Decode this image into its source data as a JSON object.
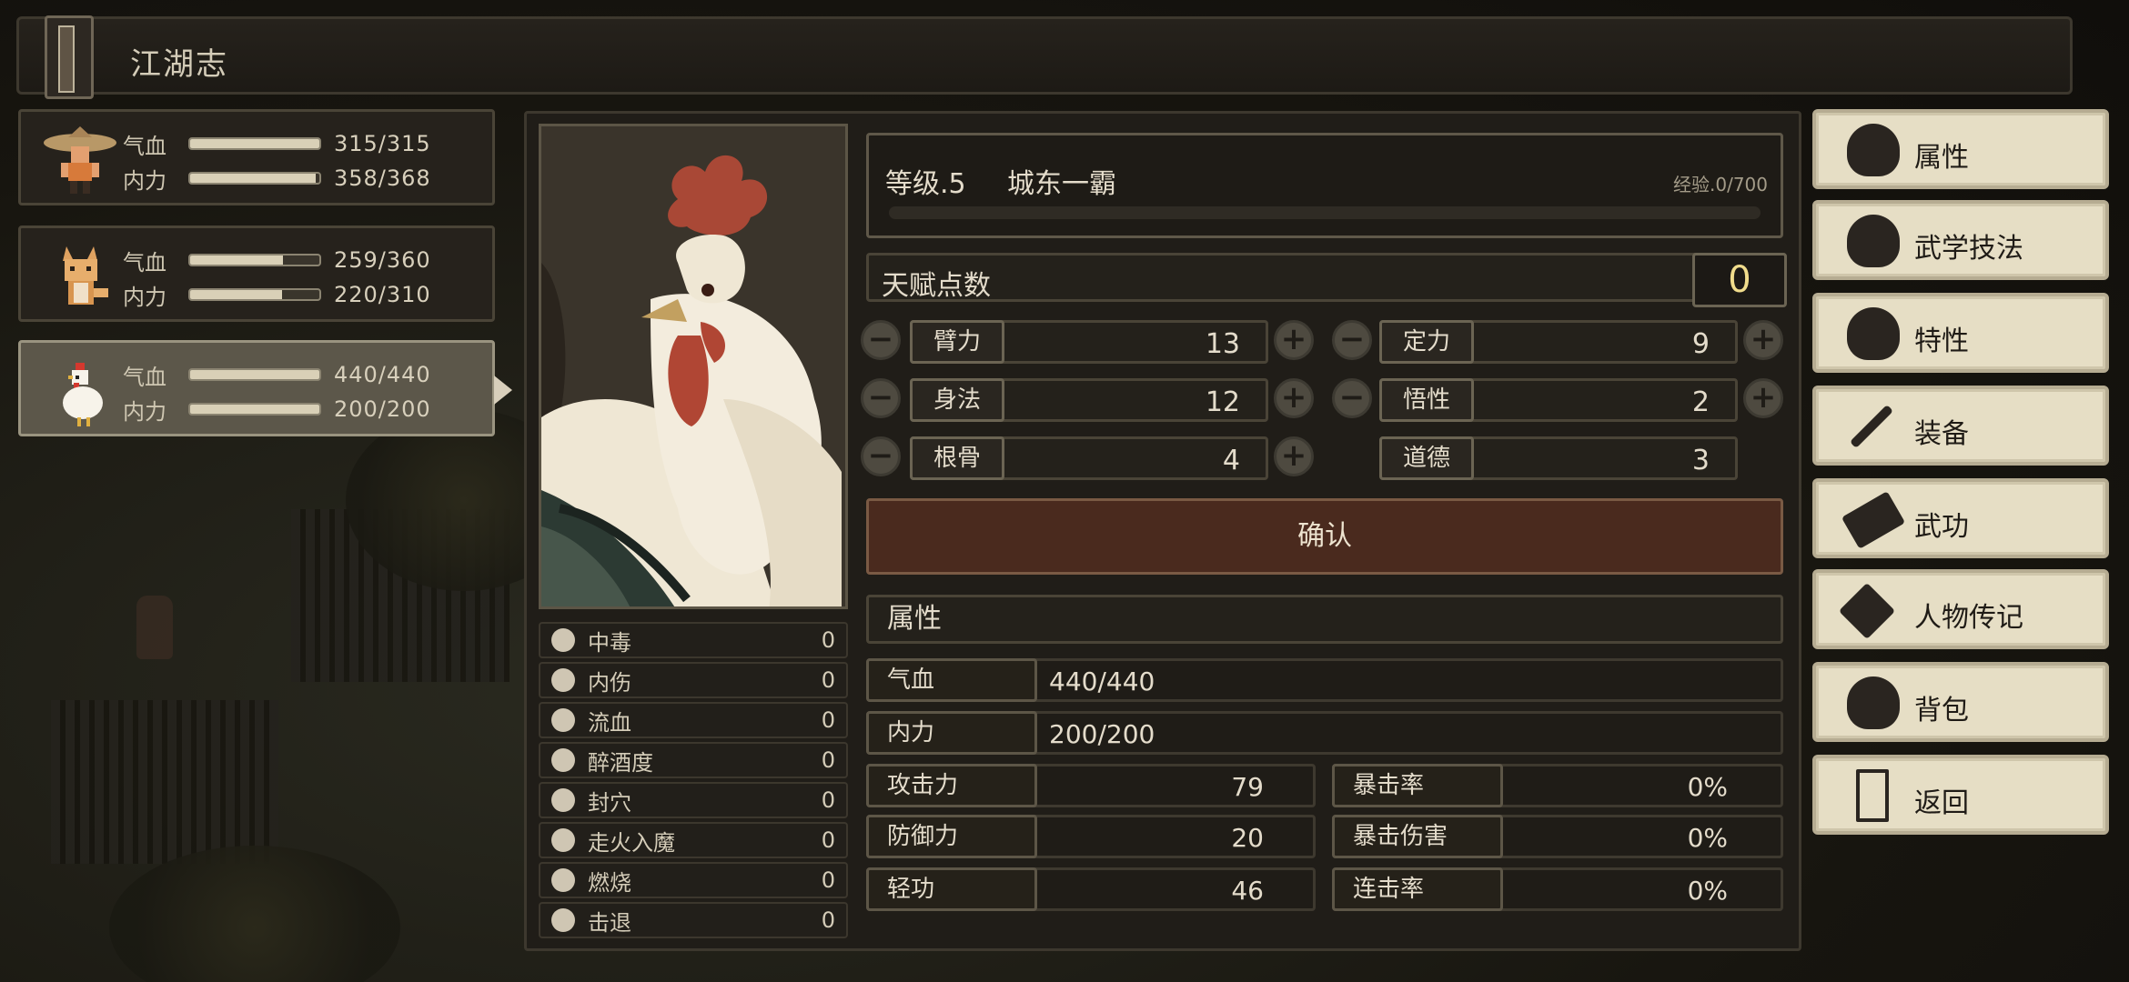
{
  "window": {
    "title": "江湖志"
  },
  "party": [
    {
      "name_icon": "straw-hat-hero-avatar",
      "hp_label": "气血",
      "hp": "315/315",
      "hp_frac": 1.0,
      "mp_label": "内力",
      "mp": "358/368",
      "mp_frac": 0.973,
      "active": false
    },
    {
      "name_icon": "fox-companion-avatar",
      "hp_label": "气血",
      "hp": "259/360",
      "hp_frac": 0.72,
      "mp_label": "内力",
      "mp": "220/310",
      "mp_frac": 0.71,
      "active": false
    },
    {
      "name_icon": "rooster-companion-avatar",
      "hp_label": "气血",
      "hp": "440/440",
      "hp_frac": 1.0,
      "mp_label": "内力",
      "mp": "200/200",
      "mp_frac": 1.0,
      "active": true
    }
  ],
  "level": {
    "label": "等级.5",
    "title": "城东一霸",
    "exp": "经验.0/700",
    "exp_frac": 0
  },
  "talent": {
    "label": "天赋点数",
    "value": "0"
  },
  "stats": {
    "arm": {
      "name": "臂力",
      "value": "13"
    },
    "focus": {
      "name": "定力",
      "value": "9"
    },
    "agility": {
      "name": "身法",
      "value": "12"
    },
    "insight": {
      "name": "悟性",
      "value": "2"
    },
    "constitution": {
      "name": "根骨",
      "value": "4"
    },
    "morality": {
      "name": "道德",
      "value": "3"
    }
  },
  "confirm_label": "确认",
  "attributes": {
    "header": "属性",
    "hp": {
      "name": "气血",
      "value": "440/440"
    },
    "mp": {
      "name": "内力",
      "value": "200/200"
    },
    "attack": {
      "name": "攻击力",
      "value": "79"
    },
    "defense": {
      "name": "防御力",
      "value": "20"
    },
    "qinggong": {
      "name": "轻功",
      "value": "46"
    },
    "crit_rate": {
      "name": "暴击率",
      "value": "0%"
    },
    "crit_damage": {
      "name": "暴击伤害",
      "value": "0%"
    },
    "combo_rate": {
      "name": "连击率",
      "value": "0%"
    }
  },
  "status_effects": [
    {
      "icon": "skull-icon",
      "name": "中毒",
      "value": "0"
    },
    {
      "icon": "broken-heart-icon",
      "name": "内伤",
      "value": "0"
    },
    {
      "icon": "blood-drop-icon",
      "name": "流血",
      "value": "0"
    },
    {
      "icon": "dizzy-face-icon",
      "name": "醉酒度",
      "value": "0"
    },
    {
      "icon": "pressure-point-icon",
      "name": "封穴",
      "value": "0"
    },
    {
      "icon": "demon-face-icon",
      "name": "走火入魔",
      "value": "0"
    },
    {
      "icon": "flame-icon",
      "name": "燃烧",
      "value": "0"
    },
    {
      "icon": "boot-icon",
      "name": "击退",
      "value": "0"
    }
  ],
  "menu": [
    {
      "icon": "character-icon",
      "label": "属性"
    },
    {
      "icon": "martial-skill-icon",
      "label": "武学技法"
    },
    {
      "icon": "trait-icon",
      "label": "特性"
    },
    {
      "icon": "sword-icon",
      "label": "装备"
    },
    {
      "icon": "scroll-book-icon",
      "label": "武功"
    },
    {
      "icon": "biography-book-icon",
      "label": "人物传记"
    },
    {
      "icon": "backpack-icon",
      "label": "背包"
    },
    {
      "icon": "door-exit-icon",
      "label": "返回"
    }
  ],
  "colors": {
    "accent_gold": "#f0dc8c",
    "confirm_bg": "#4a2a1e",
    "menu_bg": "#e6dec5"
  }
}
